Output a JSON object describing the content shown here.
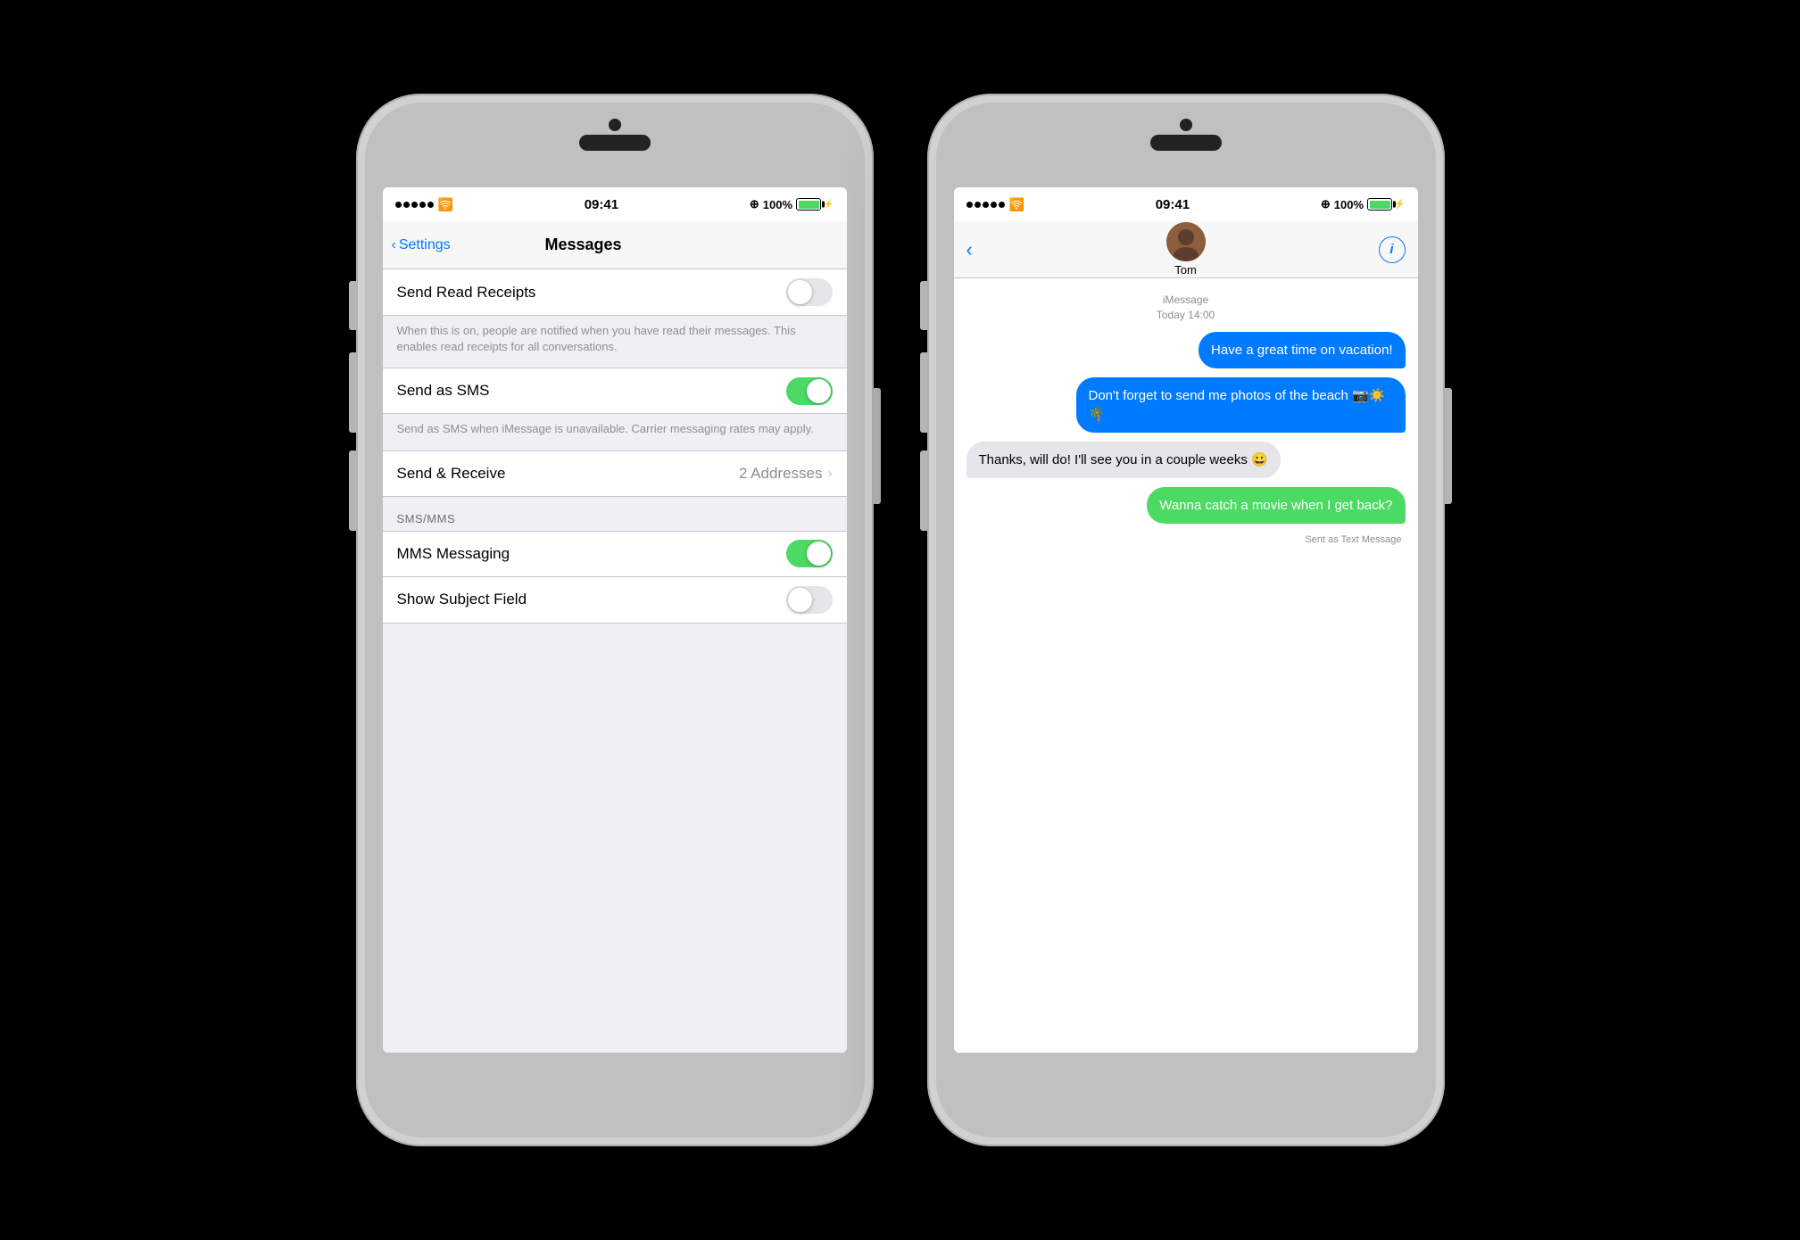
{
  "left_phone": {
    "status_bar": {
      "time": "09:41",
      "signal": "•••••",
      "wifi": "WiFi",
      "location": "⊕",
      "battery_pct": "100%"
    },
    "nav": {
      "back_label": "Settings",
      "title": "Messages"
    },
    "rows": [
      {
        "id": "send-read-receipts",
        "label": "Send Read Receipts",
        "toggle": false,
        "description": "When this is on, people are notified when you have read their messages. This enables read receipts for all conversations."
      },
      {
        "id": "send-as-sms",
        "label": "Send as SMS",
        "toggle": true,
        "description": "Send as SMS when iMessage is unavailable. Carrier messaging rates may apply."
      },
      {
        "id": "send-receive",
        "label": "Send & Receive",
        "value": "2 Addresses",
        "toggle": null
      }
    ],
    "sms_section": {
      "header": "SMS/MMS",
      "rows": [
        {
          "id": "mms-messaging",
          "label": "MMS Messaging",
          "toggle": true
        },
        {
          "id": "show-subject-field",
          "label": "Show Subject Field",
          "toggle": false
        }
      ]
    }
  },
  "right_phone": {
    "status_bar": {
      "time": "09:41",
      "battery_pct": "100%"
    },
    "contact": {
      "name": "Tom"
    },
    "messages": {
      "timestamp": "iMessage\nToday 14:00",
      "bubbles": [
        {
          "id": "msg1",
          "type": "sent",
          "color": "blue",
          "text": "Have a great time on vacation!"
        },
        {
          "id": "msg2",
          "type": "sent",
          "color": "blue",
          "text": "Don't forget to send me photos of the beach 📷☀️🌴"
        },
        {
          "id": "msg3",
          "type": "received",
          "color": "gray",
          "text": "Thanks, will do! I'll see you in a couple weeks 😀"
        },
        {
          "id": "msg4",
          "type": "sent",
          "color": "green",
          "text": "Wanna catch a movie when I get back?"
        }
      ],
      "sent_as_label": "Sent as Text Message"
    }
  }
}
